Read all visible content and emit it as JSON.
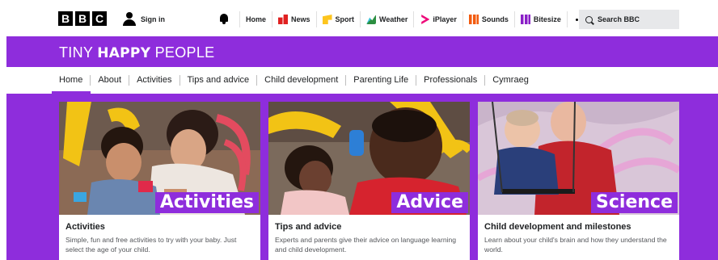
{
  "bbc": {
    "logo_letters": [
      "B",
      "B",
      "C"
    ],
    "sign_in": "Sign in",
    "nav": [
      {
        "label": "Home",
        "icon": ""
      },
      {
        "label": "News",
        "icon": "news-icon",
        "color": "#e02020"
      },
      {
        "label": "Sport",
        "icon": "sport-icon",
        "color": "#fdc51e"
      },
      {
        "label": "Weather",
        "icon": "weather-icon",
        "color": "#39c2d8"
      },
      {
        "label": "iPlayer",
        "icon": "iplayer-icon",
        "color": "#ee0a7a"
      },
      {
        "label": "Sounds",
        "icon": "sounds-icon",
        "color": "#f25b0f"
      },
      {
        "label": "Bitesize",
        "icon": "bitesize-icon",
        "color": "#8a1fc7"
      }
    ],
    "search_label": "Search BBC"
  },
  "site": {
    "title_part1": "TINY ",
    "title_part2": "HAPPY",
    "title_part3": " PEOPLE",
    "accent": "#8e2ddc"
  },
  "subnav": {
    "items": [
      "Home",
      "About",
      "Activities",
      "Tips and advice",
      "Child development",
      "Parenting Life",
      "Professionals",
      "Cymraeg"
    ],
    "active": "Home"
  },
  "cards": [
    {
      "badge": "Activities",
      "title": "Activities",
      "description": "Simple, fun and free activities to try with your baby. Just select the age of your child."
    },
    {
      "badge": "Advice",
      "title": "Tips and advice",
      "description": "Experts and parents give their advice on language learning and child development."
    },
    {
      "badge": "Science",
      "title": "Child development and milestones",
      "description": "Learn about your child's brain and how they understand the world."
    }
  ]
}
